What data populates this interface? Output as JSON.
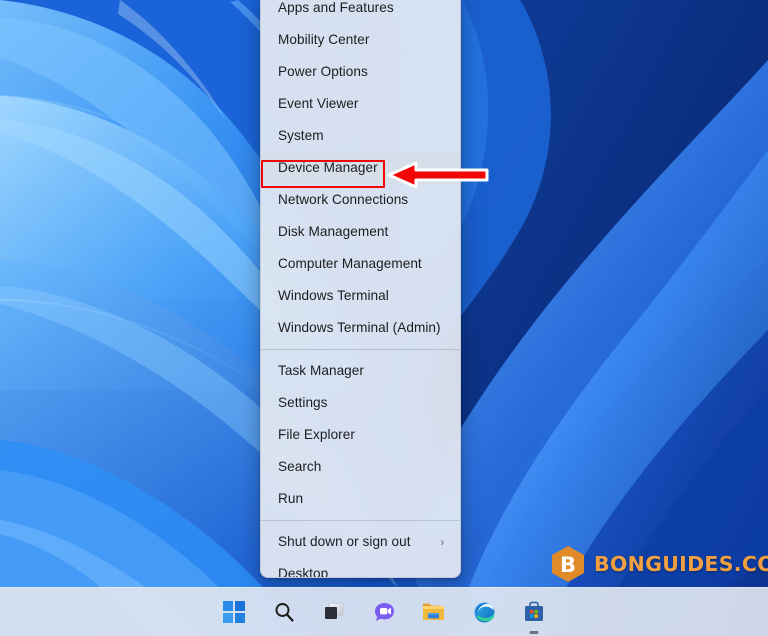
{
  "desktop": {
    "wallpaper_name": "windows-11-bloom-wallpaper",
    "background_colors": {
      "light_blue": "#4aa8fb",
      "mid_blue": "#1f74ea",
      "deep_blue": "#0c3ba8",
      "dark_blue": "#0a2f8c"
    }
  },
  "winx_menu": {
    "name": "win-x-quick-link-menu",
    "groups": [
      {
        "items": [
          {
            "label": "Apps and Features",
            "has_submenu": false,
            "hovered": false
          },
          {
            "label": "Mobility Center",
            "has_submenu": false,
            "hovered": false
          },
          {
            "label": "Power Options",
            "has_submenu": false,
            "hovered": false
          },
          {
            "label": "Event Viewer",
            "has_submenu": false,
            "hovered": false
          },
          {
            "label": "System",
            "has_submenu": false,
            "hovered": false
          },
          {
            "label": "Device Manager",
            "has_submenu": false,
            "hovered": true
          },
          {
            "label": "Network Connections",
            "has_submenu": false,
            "hovered": false
          },
          {
            "label": "Disk Management",
            "has_submenu": false,
            "hovered": false
          },
          {
            "label": "Computer Management",
            "has_submenu": false,
            "hovered": false
          },
          {
            "label": "Windows Terminal",
            "has_submenu": false,
            "hovered": false
          },
          {
            "label": "Windows Terminal (Admin)",
            "has_submenu": false,
            "hovered": false
          }
        ]
      },
      {
        "items": [
          {
            "label": "Task Manager",
            "has_submenu": false,
            "hovered": false
          },
          {
            "label": "Settings",
            "has_submenu": false,
            "hovered": false
          },
          {
            "label": "File Explorer",
            "has_submenu": false,
            "hovered": false
          },
          {
            "label": "Search",
            "has_submenu": false,
            "hovered": false
          },
          {
            "label": "Run",
            "has_submenu": false,
            "hovered": false
          }
        ]
      },
      {
        "items": [
          {
            "label": "Shut down or sign out",
            "has_submenu": true,
            "submenu_glyph": "›",
            "hovered": false
          },
          {
            "label": "Desktop",
            "has_submenu": false,
            "hovered": false
          }
        ]
      }
    ]
  },
  "annotation": {
    "highlight_box": {
      "name": "device-manager-highlight-box",
      "target_label": "Device Manager",
      "color": "#f20505"
    },
    "arrow": {
      "name": "red-pointer-arrow",
      "direction": "left",
      "fill": "#f20505",
      "outline": "#ffffff"
    }
  },
  "watermark": {
    "text": "BONGUIDES.COM",
    "logo_letter": "B",
    "text_color": "#f0a040",
    "logo_color": "#e08a2a"
  },
  "taskbar": {
    "items": [
      {
        "name": "start-button",
        "icon": "windows-logo-icon",
        "label": "Start",
        "running": false
      },
      {
        "name": "search-button",
        "icon": "search-icon",
        "label": "Search",
        "running": false
      },
      {
        "name": "task-view-button",
        "icon": "task-view-icon",
        "label": "Task View",
        "running": false
      },
      {
        "name": "chat-button",
        "icon": "chat-icon",
        "label": "Chat",
        "running": false
      },
      {
        "name": "file-explorer-button",
        "icon": "file-explorer-icon",
        "label": "File Explorer",
        "running": false
      },
      {
        "name": "edge-button",
        "icon": "edge-icon",
        "label": "Microsoft Edge",
        "running": false
      },
      {
        "name": "store-button",
        "icon": "microsoft-store-icon",
        "label": "Microsoft Store",
        "running": true
      }
    ]
  }
}
